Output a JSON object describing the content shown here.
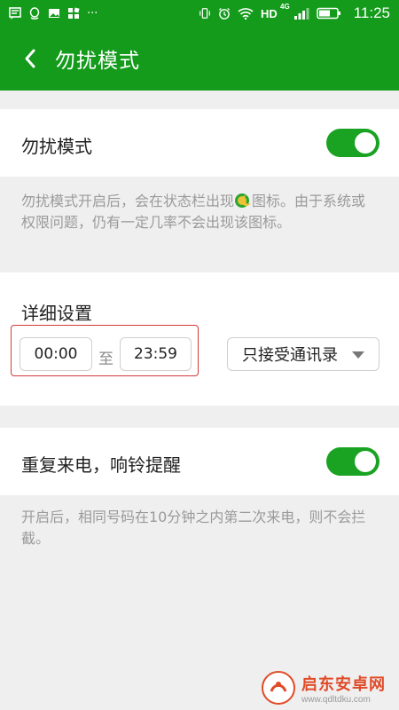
{
  "status_bar": {
    "left_icons": [
      "message-icon",
      "qq-icon",
      "image-icon",
      "app-grid-icon"
    ],
    "more": "···",
    "network": "HD",
    "network_sup": "4G",
    "time": "11:25"
  },
  "app_bar": {
    "title": "勿扰模式"
  },
  "dnd": {
    "label": "勿扰模式",
    "enabled": true,
    "description_before": "勿扰模式开启后，会在状态栏出现",
    "description_after": "图标。由于系统或权限问题，仍有一定几率不会出现该图标。"
  },
  "details": {
    "title": "详细设置",
    "start_time": "00:00",
    "to_label": "至",
    "end_time": "23:59",
    "mode_selected": "只接受通讯录"
  },
  "repeat_call": {
    "label": "重复来电，响铃提醒",
    "enabled": true,
    "description": "开启后，相同号码在10分钟之内第二次来电，则不会拦截。"
  },
  "watermark": {
    "name": "启东安卓网",
    "url": "www.qdltdku.com"
  },
  "colors": {
    "primary": "#149b1c",
    "toggle_on": "#1aa222",
    "highlight_frame": "#d23a3a",
    "background": "#efefef"
  }
}
